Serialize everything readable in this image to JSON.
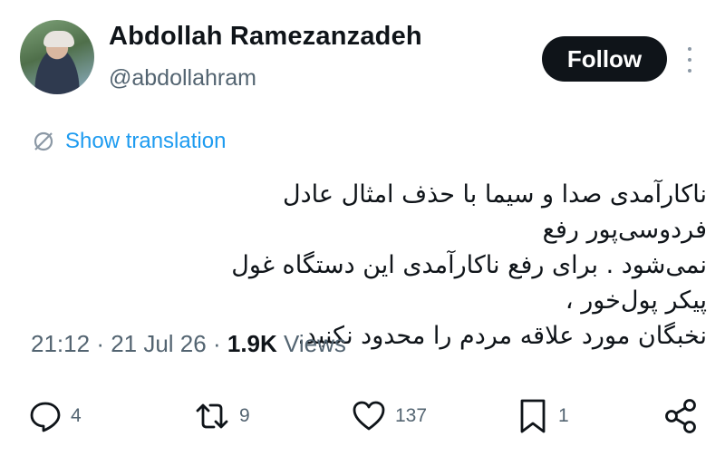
{
  "author": {
    "name": "Abdollah Ramezanzadeh",
    "handle": "@abdollahram"
  },
  "follow_label": "Follow",
  "translate_label": "Show translation",
  "tweet": {
    "lines": [
      "ناکارآمدی صدا و سیما با حذف امثال عادل فردوسی‌پور رفع",
      "نمی‌شود . برای رفع ناکارآمدی این دستگاه غول پیکر پول‌خور ،",
      "نخبگان مورد علاقه مردم را محدود نکنید."
    ]
  },
  "meta": {
    "time": "21:12",
    "date": "21 Jul 26",
    "views_count": "1.9K",
    "views_label": "Views"
  },
  "actions": {
    "replies": "4",
    "reposts": "9",
    "likes": "137",
    "bookmarks": "1"
  },
  "icons": {
    "more": "more-icon",
    "translate": "translate-icon",
    "reply": "reply-icon",
    "repost": "repost-icon",
    "like": "heart-icon",
    "bookmark": "bookmark-icon",
    "share": "share-icon"
  },
  "colors": {
    "accent": "#1d9bf0",
    "muted": "#536471",
    "text": "#0f1419"
  }
}
